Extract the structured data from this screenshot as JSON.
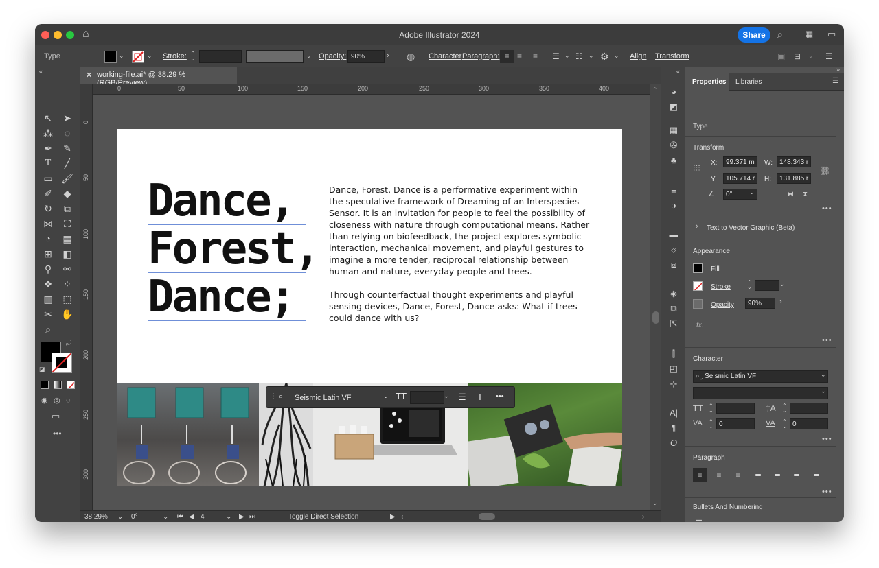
{
  "window": {
    "title": "Adobe Illustrator 2024",
    "share_label": "Share"
  },
  "controlbar": {
    "selection_type": "Type",
    "stroke_label": "Stroke:",
    "opacity_label": "Opacity:",
    "opacity_value": "90%",
    "character_label": "Character",
    "paragraph_label": "Paragraph:",
    "align_label": "Align",
    "transform_label": "Transform"
  },
  "document": {
    "tab_label": "working-file.ai* @ 38.29 % (RGB/Preview)",
    "ruler_h_ticks": [
      "0",
      "50",
      "100",
      "150",
      "200",
      "250",
      "300",
      "350",
      "400"
    ],
    "ruler_v_ticks": [
      "0",
      "50",
      "100",
      "150",
      "200",
      "250",
      "300"
    ]
  },
  "artboard": {
    "headline_lines": [
      "Dance,",
      "Forest,",
      "Dance;"
    ],
    "paragraph_1": "Dance, Forest, Dance is a performative experiment within the speculative framework of Dreaming of an Interspecies Sensor. It is an invitation for people to feel the possibility of closeness with nature through computational means. Rather than relying on biofeedback, the project explores symbolic interaction,  mechanical movement, and playful gestures to imagine a more tender, reciprocal relationship between human and nature, everyday people and trees.",
    "paragraph_2": "Through counterfactual thought experiments and playful sensing devices, Dance, Forest, Dance asks: What if trees could dance with us?"
  },
  "floating_toolbar": {
    "font": "Seismic Latin VF"
  },
  "statusbar": {
    "zoom": "38.29%",
    "rotation": "0°",
    "artboard_number": "4",
    "status_text": "Toggle Direct Selection"
  },
  "properties": {
    "tab_properties": "Properties",
    "tab_libraries": "Libraries",
    "selection_type": "Type",
    "transform_title": "Transform",
    "x_label": "X:",
    "x_value": "99.371 m",
    "y_label": "Y:",
    "y_value": "105.714 r",
    "w_label": "W:",
    "w_value": "148.343 r",
    "h_label": "H:",
    "h_value": "131.885 r",
    "rotate_value": "0°",
    "text_to_vector": "Text to Vector Graphic (Beta)",
    "appearance_title": "Appearance",
    "fill_label": "Fill",
    "stroke_label": "Stroke",
    "opacity_label": "Opacity",
    "opacity_value": "90%",
    "fx_label": "fx.",
    "character_title": "Character",
    "font_family": "Seismic Latin VF",
    "tracking_value": "0",
    "kerning_value": "0",
    "paragraph_title": "Paragraph",
    "bullets_title": "Bullets And Numbering"
  },
  "colors": {
    "accent": "#1473e6",
    "ui_dark": "#424242",
    "ui_mid": "#535353"
  }
}
